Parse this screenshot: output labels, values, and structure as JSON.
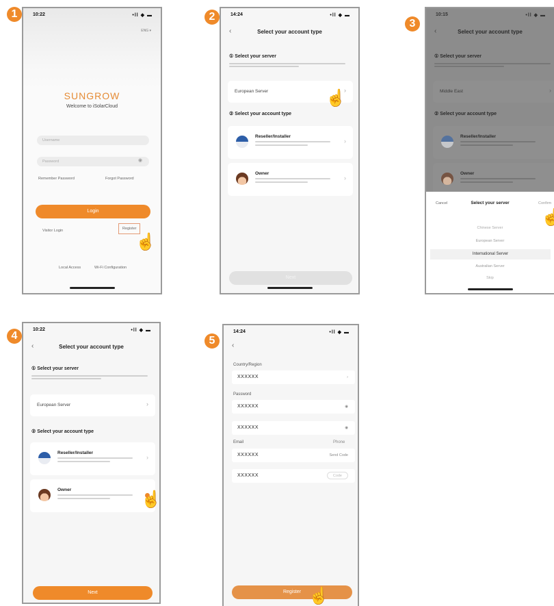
{
  "steps": [
    "1",
    "2",
    "3",
    "4",
    "5"
  ],
  "phone1": {
    "time": "10:22",
    "signal": "•ll ◆ ▬",
    "lang": "ENG ▾",
    "brand": "SUNGROW",
    "welcome": "Welcome to iSolarCloud",
    "username_placeholder": "Username",
    "password_placeholder": "Password",
    "remember": "Remember Password",
    "forgot": "Forgot Password",
    "login": "Login",
    "visitor": "Visitor Login",
    "register": "Register",
    "local_access": "Local Access",
    "wifi_config": "Wi-Fi Configuration"
  },
  "phone2": {
    "time": "14:24",
    "signal": "•ll ◆ ▬",
    "title": "Select your account type",
    "sec1": "① Select your server",
    "server": "European Server",
    "sec2": "② Select your account type",
    "acct1": "Reseller/Installer",
    "acct2": "Owner",
    "next": "Next"
  },
  "phone3": {
    "time": "10:15",
    "signal": "•ll ◆ ▬",
    "title": "Select your account type",
    "sec1": "① Select your server",
    "server": "Middle East",
    "sec2": "② Select your account type",
    "acct1": "Reseller/Installer",
    "acct2": "Owner",
    "cancel": "Cancel",
    "picker_title": "Select your server",
    "confirm": "Confirm",
    "options": [
      "Chinese Server",
      "European Server",
      "International Server",
      "Australian Server",
      "Skip"
    ]
  },
  "phone4": {
    "time": "10:22",
    "signal": "•ll ◆ ▬",
    "title": "Select your account type",
    "sec1": "① Select your server",
    "server": "European Server",
    "sec2": "② Select your account type",
    "acct1": "Reseller/Installer",
    "acct2": "Owner",
    "next": "Next"
  },
  "phone5": {
    "time": "14:24",
    "signal": "•ll ◆ ▬",
    "country_label": "Country/Region",
    "country_value": "XXXXXX",
    "password_label": "Password",
    "password_value": "XXXXXX",
    "confirm_value": "XXXXXX",
    "email_label": "Email",
    "phone_link": "Phone",
    "email_value": "XXXXXX",
    "send_code": "Send Code",
    "code_value": "XXXXXX",
    "code_hint": "Code",
    "register": "Register"
  },
  "colors": {
    "accent": "#ef8a2a",
    "overlay": "#8c8c8c"
  },
  "icons": {
    "pointer": "hand-pointer-icon",
    "back": "chevron-left-icon",
    "chevron": "chevron-right-icon"
  }
}
